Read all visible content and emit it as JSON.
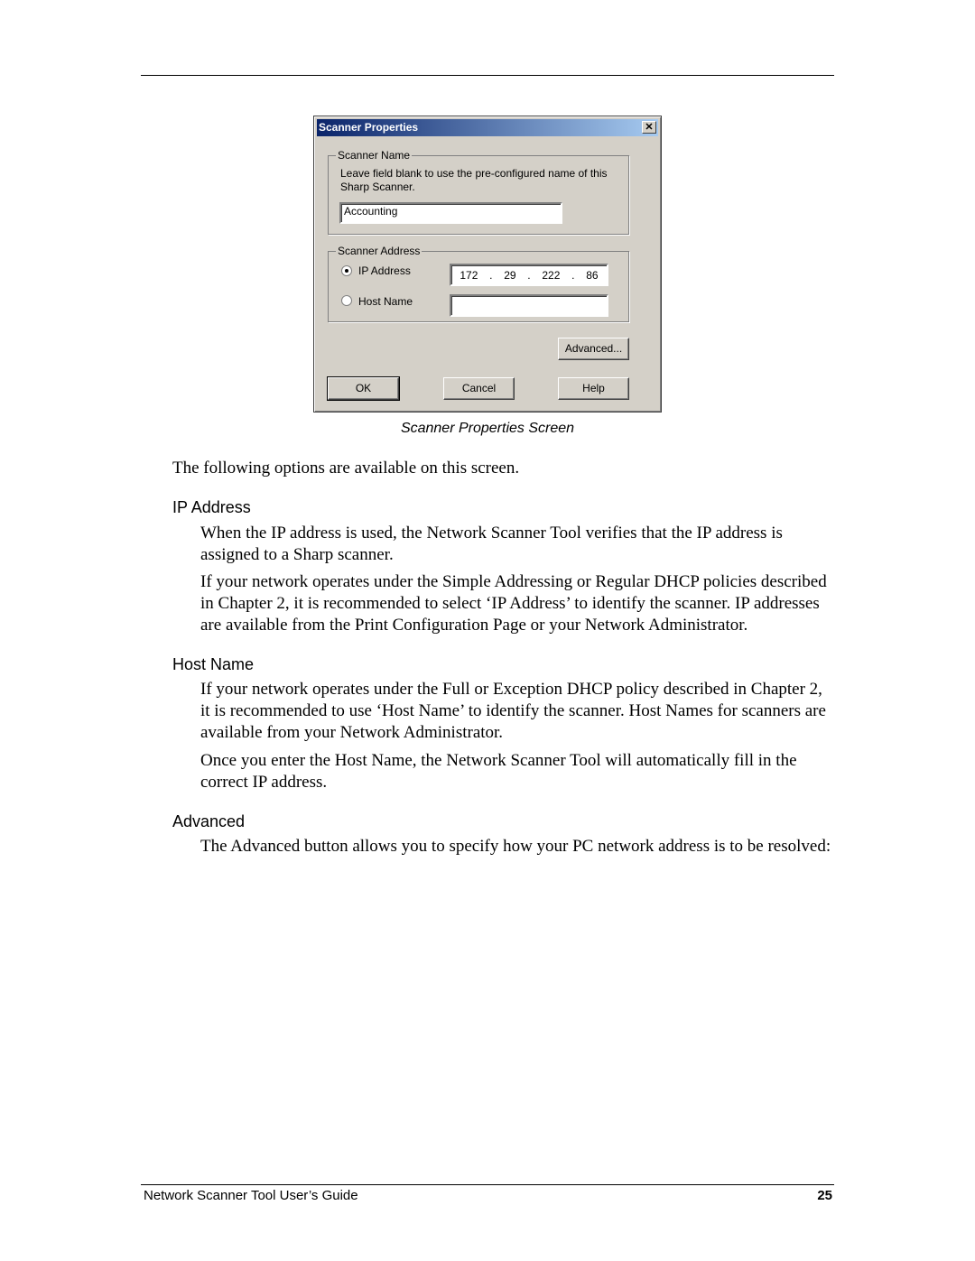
{
  "dialog": {
    "title": "Scanner Properties",
    "close": "✕",
    "name_group": "Scanner Name",
    "name_help": "Leave field blank to use the pre-configured name of this Sharp Scanner.",
    "name_value": "Accounting",
    "address_group": "Scanner Address",
    "ip_label": "IP Address",
    "ip_selected": true,
    "ip_octets": [
      "172",
      "29",
      "222",
      "86"
    ],
    "host_label": "Host Name",
    "host_value": "",
    "advanced": "Advanced...",
    "ok": "OK",
    "cancel": "Cancel",
    "help": "Help"
  },
  "caption": "Scanner Properties Screen",
  "intro": "The following options are available on this screen.",
  "sections": [
    {
      "heading": "IP Address",
      "paras": [
        "When the IP address is used, the Network Scanner Tool verifies that the IP address is assigned to a Sharp scanner.",
        "If your network operates under the Simple Addressing or Regular DHCP policies described in Chapter 2, it is recommended to select ‘IP Address’ to identify the scanner. IP addresses are available from the Print Configuration Page or your Network Administrator."
      ]
    },
    {
      "heading": "Host Name",
      "paras": [
        "If your network operates under the Full or Exception DHCP policy described in Chapter 2, it is recommended to use ‘Host Name’ to identify the scanner. Host Names for scanners are available from your Network Administrator.",
        "Once you enter the Host Name, the Network Scanner Tool will automatically fill in the correct IP address."
      ]
    },
    {
      "heading": "Advanced",
      "paras": [
        "The Advanced button allows you to specify how your PC network address is to be resolved:"
      ]
    }
  ],
  "footer": {
    "title": "Network Scanner Tool User’s Guide",
    "page": "25"
  }
}
